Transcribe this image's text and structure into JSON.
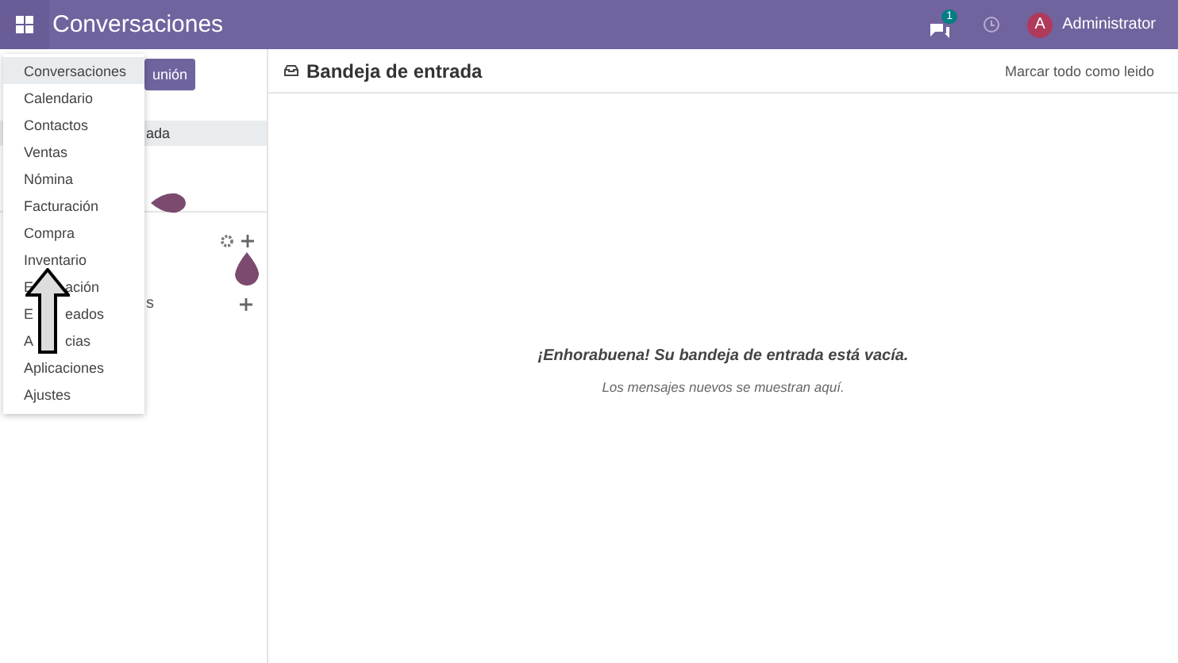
{
  "topbar": {
    "app_title": "Conversaciones",
    "messages_badge": "1",
    "user_initial": "A",
    "user_name": "Administrator"
  },
  "sidebar": {
    "button": "unión",
    "items": [
      {
        "label": "ada",
        "selected": true
      }
    ],
    "section_label": "s"
  },
  "app_menu": {
    "items": [
      {
        "label": [
          "Conversaciones"
        ],
        "selected": true
      },
      {
        "label": [
          "Calendario"
        ],
        "selected": false
      },
      {
        "label": [
          "Contactos"
        ],
        "selected": false
      },
      {
        "label": [
          "Ventas"
        ],
        "selected": false
      },
      {
        "label": [
          "Nómina"
        ],
        "selected": false
      },
      {
        "label": [
          "Facturación"
        ],
        "selected": false
      },
      {
        "label": [
          "Compra"
        ],
        "selected": false
      },
      {
        "label": [
          "Inventario"
        ],
        "selected": false
      },
      {
        "label": [
          "E",
          "ación"
        ],
        "selected": false
      },
      {
        "label": [
          "E",
          "eados"
        ],
        "selected": false
      },
      {
        "label": [
          "A",
          "cias"
        ],
        "selected": false
      },
      {
        "label": [
          "Aplicaciones"
        ],
        "selected": false
      },
      {
        "label": [
          "Ajustes"
        ],
        "selected": false
      }
    ]
  },
  "inbox": {
    "title": "Bandeja de entrada",
    "mark_all_button": "Marcar todo como leido"
  },
  "empty_state": {
    "title": "¡Enhorabuena! Su bandeja de entrada está vacía.",
    "subtitle": "Los mensajes nuevos se muestran aquí."
  }
}
